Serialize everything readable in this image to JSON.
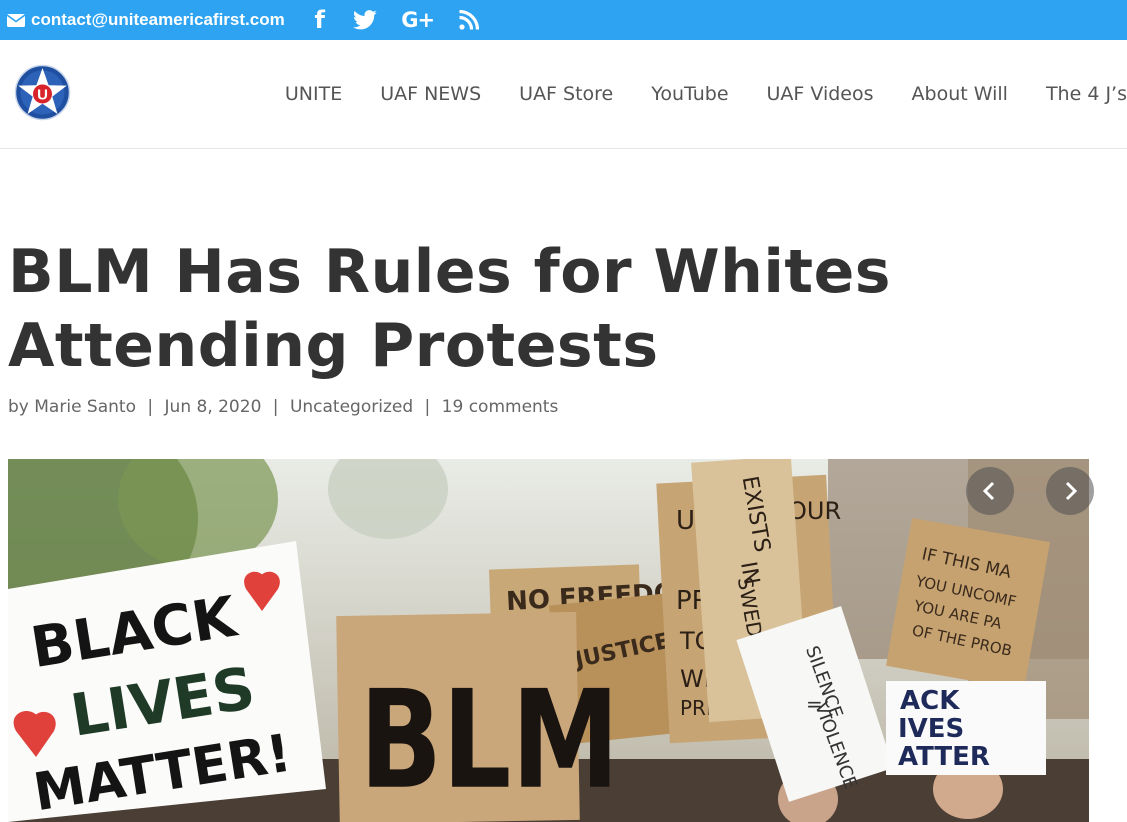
{
  "topbar": {
    "email": "contact@uniteamericafirst.com",
    "icons": [
      "mail-icon",
      "facebook-icon",
      "twitter-icon",
      "google-plus-icon",
      "rss-icon"
    ],
    "facebook_glyph": "f",
    "googleplus_glyph": "G+"
  },
  "logo": {
    "letter": "U"
  },
  "nav": {
    "items": [
      "UNITE",
      "UAF NEWS",
      "UAF Store",
      "YouTube",
      "UAF Videos",
      "About Will",
      "The 4 J’s"
    ]
  },
  "article": {
    "title_line1": "BLM Has Rules for Whites",
    "title_line2": "Attending Protests",
    "meta": {
      "by": "by",
      "author": "Marie Santo",
      "date": "Jun 8, 2020",
      "category": "Uncategorized",
      "comments": "19 comments"
    }
  },
  "hero": {
    "signs": {
      "black_lives_1": "BLACK",
      "black_lives_2": "LIVES",
      "black_lives_3": "MATTER!",
      "blm": "BLM",
      "no_freedom": "NO FREEDOM",
      "exists_1": "EXISTS",
      "exists_2": "IN",
      "exists_3": "SWEDEN",
      "if_this_1": "IF THIS MA",
      "if_this_2": "YOU UNCOMF",
      "if_this_3": "YOU ARE PA",
      "if_this_4": "OF THE PROB",
      "silence_1": "SILENCE",
      "silence_2": "=",
      "silence_3": "VIOLENCE",
      "ack_1": "ACK",
      "ack_2": "IVES",
      "ack_3": "ATTER",
      "justice": "JUSTICE",
      "privilege_1": "U",
      "privilege_2": "OUR",
      "privilege_3": "PR",
      "privilege_4": "TO",
      "privilege_5": "WH",
      "privilege_6": "PRIV"
    }
  },
  "slider": {
    "prev": "previous-slide",
    "next": "next-slide"
  },
  "colors": {
    "topbar": "#2ea3f2",
    "title": "#333333",
    "nav": "#555555",
    "meta": "#666666"
  }
}
